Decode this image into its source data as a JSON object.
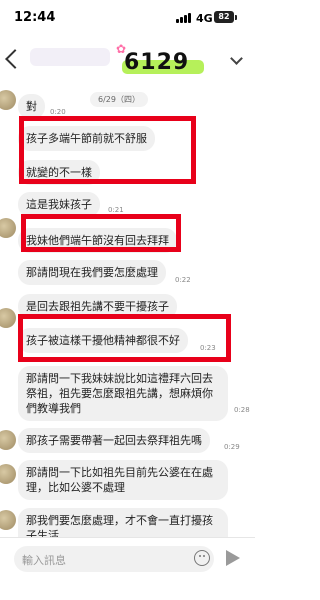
{
  "status": {
    "time": "12:44",
    "network": "4G",
    "battery": "82"
  },
  "header": {
    "sticker_text": "6129"
  },
  "chat": {
    "date_chip": "6/29（四）",
    "messages": [
      {
        "text": "對",
        "time": "0:20"
      },
      {
        "text": "孩子多端午節前就不舒服",
        "time": ""
      },
      {
        "text": "就變的不一樣",
        "time": ""
      },
      {
        "text": "這是我妹孩子",
        "time": "0:21"
      },
      {
        "text": "我妹他們端午節沒有回去拜拜",
        "time": ""
      },
      {
        "text": "那請問現在我們要怎麼處理",
        "time": "0:22"
      },
      {
        "text": "是回去跟祖先講不要干擾孩子",
        "time": ""
      },
      {
        "text": "孩子被這樣干擾他精神都很不好",
        "time": "0:23"
      },
      {
        "text": "那請問一下我妹妹說比如這禮拜六回去祭祖，祖先要怎麼跟祖先講，想麻煩你們教導我們",
        "time": "0:28"
      },
      {
        "text": "那孩子需要帶著一起回去祭拜祖先嗎",
        "time": "0:29"
      },
      {
        "text": "那請問一下比如祖先目前先公婆在在處理，比如公婆不處理",
        "time": ""
      },
      {
        "text": "那我們要怎麼處理，才不會一直打擾孩子生活",
        "time": ""
      }
    ]
  },
  "input": {
    "placeholder": "輸入訊息"
  },
  "colors": {
    "highlight_box": "#e8001a",
    "bubble": "#f0f0f0",
    "sticker_highlight": "#b6f05a"
  },
  "icons": [
    "back-icon",
    "chevron-down-icon",
    "emoji-icon",
    "send-icon"
  ]
}
